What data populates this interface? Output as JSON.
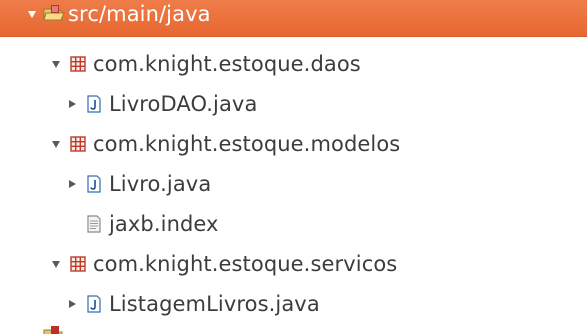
{
  "tree": {
    "source_folder": {
      "label": "src/main/java",
      "icon": "source-folder-icon",
      "expanded": true,
      "selected": true
    },
    "packages": [
      {
        "label": "com.knight.estoque.daos",
        "icon": "package-icon",
        "expanded": true,
        "children": [
          {
            "label": "LivroDAO.java",
            "icon": "java-file-icon",
            "expandable": true
          }
        ]
      },
      {
        "label": "com.knight.estoque.modelos",
        "icon": "package-icon",
        "expanded": true,
        "children": [
          {
            "label": "Livro.java",
            "icon": "java-file-icon",
            "expandable": true
          },
          {
            "label": "jaxb.index",
            "icon": "text-file-icon",
            "expandable": false
          }
        ]
      },
      {
        "label": "com.knight.estoque.servicos",
        "icon": "package-icon",
        "expanded": true,
        "children": [
          {
            "label": "ListagemLivros.java",
            "icon": "java-file-icon",
            "expandable": true
          }
        ]
      }
    ]
  },
  "colors": {
    "selection": "#ec7440",
    "text": "#3c3c3c",
    "package_icon": "#c03a2b",
    "java_icon": "#2f6fb5"
  }
}
